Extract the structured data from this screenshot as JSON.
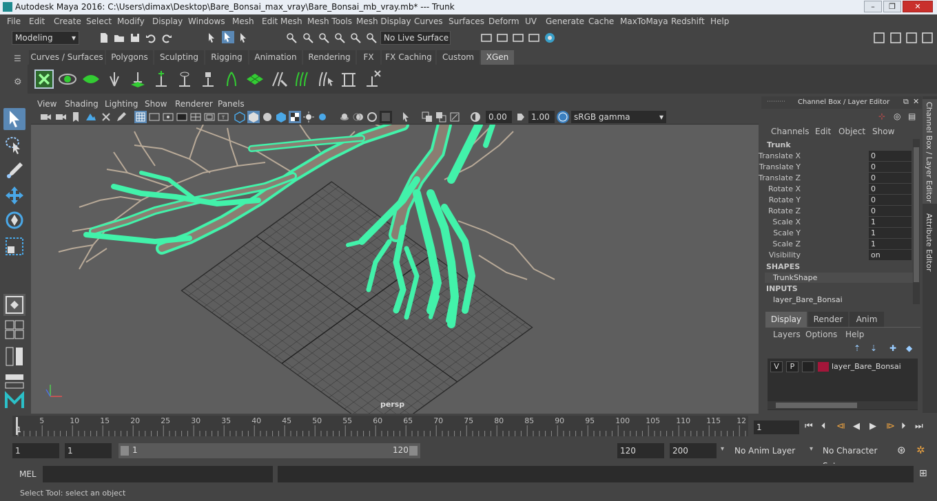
{
  "window": {
    "title": "Autodesk Maya 2016: C:\\Users\\dimax\\Desktop\\Bare_Bonsai_max_vray\\Bare_Bonsai_mb_vray.mb*   ---   Trunk",
    "minimize": "–",
    "maximize": "❐",
    "close": "✕"
  },
  "menubar": [
    "File",
    "Edit",
    "Create",
    "Select",
    "Modify",
    "Display",
    "Windows",
    "Mesh",
    "Edit Mesh",
    "Mesh Tools",
    "Mesh Display",
    "Curves",
    "Surfaces",
    "Deform",
    "UV",
    "Generate",
    "Cache",
    "MaxToMaya",
    "Redshift",
    "Help"
  ],
  "statusline": {
    "mode": "Modeling",
    "live_surface": "No Live Surface"
  },
  "shelf_tabs": [
    "Curves / Surfaces",
    "Polygons",
    "Sculpting",
    "Rigging",
    "Animation",
    "Rendering",
    "FX",
    "FX Caching",
    "Custom",
    "XGen"
  ],
  "active_shelf_tab": "XGen",
  "viewport": {
    "menus": [
      "View",
      "Shading",
      "Lighting",
      "Show",
      "Renderer",
      "Panels"
    ],
    "exposure": "0.00",
    "gamma": "1.00",
    "colorspace": "sRGB gamma",
    "camera": "persp"
  },
  "channel_box": {
    "header": "Channel Box / Layer Editor",
    "menus": [
      "Channels",
      "Edit",
      "Object",
      "Show"
    ],
    "object": "Trunk",
    "attributes": [
      {
        "name": "Translate X",
        "value": "0"
      },
      {
        "name": "Translate Y",
        "value": "0"
      },
      {
        "name": "Translate Z",
        "value": "0"
      },
      {
        "name": "Rotate X",
        "value": "0"
      },
      {
        "name": "Rotate Y",
        "value": "0"
      },
      {
        "name": "Rotate Z",
        "value": "0"
      },
      {
        "name": "Scale X",
        "value": "1"
      },
      {
        "name": "Scale Y",
        "value": "1"
      },
      {
        "name": "Scale Z",
        "value": "1"
      },
      {
        "name": "Visibility",
        "value": "on"
      }
    ],
    "shapes_label": "SHAPES",
    "shape": "TrunkShape",
    "inputs_label": "INPUTS",
    "input": "layer_Bare_Bonsai"
  },
  "layer_editor": {
    "tabs": [
      "Display",
      "Render",
      "Anim"
    ],
    "active_tab": "Display",
    "menus": [
      "Layers",
      "Options",
      "Help"
    ],
    "layers": [
      {
        "v": "V",
        "p": "P",
        "name": "layer_Bare_Bonsai",
        "color": "#a3163a"
      }
    ]
  },
  "side_tabs": [
    "Channel Box / Layer Editor",
    "Attribute Editor"
  ],
  "timeline": {
    "ticks": [
      "1",
      "5",
      "10",
      "15",
      "20",
      "25",
      "30",
      "35",
      "40",
      "45",
      "50",
      "55",
      "60",
      "65",
      "70",
      "75",
      "80",
      "85",
      "90",
      "95",
      "100",
      "105",
      "110",
      "115",
      "12"
    ],
    "current_frame": "1"
  },
  "range": {
    "start": "1",
    "playback_start": "1",
    "slider_start": "1",
    "slider_end": "120",
    "playback_end": "120",
    "end": "200",
    "anim_layer": "No Anim Layer",
    "character_set": "No Character Set"
  },
  "command_line": {
    "label": "MEL"
  },
  "help_line": "Select Tool: select an object",
  "colors": {
    "accent": "#5a88b5",
    "wire": "#3ff5a8",
    "layer": "#a3163a"
  }
}
